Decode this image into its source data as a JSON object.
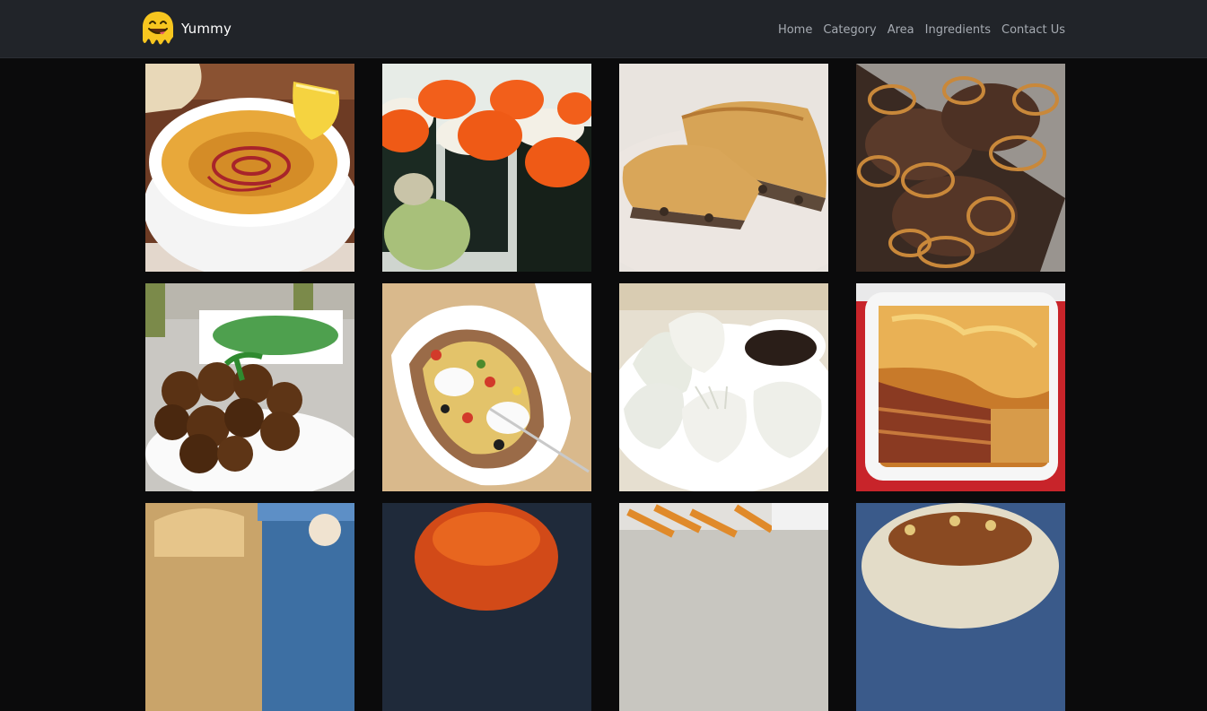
{
  "brand": {
    "name": "Yummy",
    "logo_icon": "smiley-face-logo",
    "accent": "#f7c61f"
  },
  "nav": {
    "items": [
      {
        "label": "Home"
      },
      {
        "label": "Category"
      },
      {
        "label": "Area"
      },
      {
        "label": "Ingredients"
      },
      {
        "label": "Contact Us"
      }
    ]
  },
  "colors": {
    "navbar_bg": "#212429",
    "page_bg": "#0b0b0c",
    "nav_link": "#a6abb2"
  },
  "meals": [
    {
      "name": "lentil-soup"
    },
    {
      "name": "sushi-rolls"
    },
    {
      "name": "meat-pie"
    },
    {
      "name": "liver-with-onions"
    },
    {
      "name": "falafel"
    },
    {
      "name": "stuffed-baked-potato"
    },
    {
      "name": "dumplings"
    },
    {
      "name": "lasagne"
    },
    {
      "name": "bread-basket"
    },
    {
      "name": "orange-dish"
    },
    {
      "name": "fries-dish"
    },
    {
      "name": "koshari"
    }
  ]
}
